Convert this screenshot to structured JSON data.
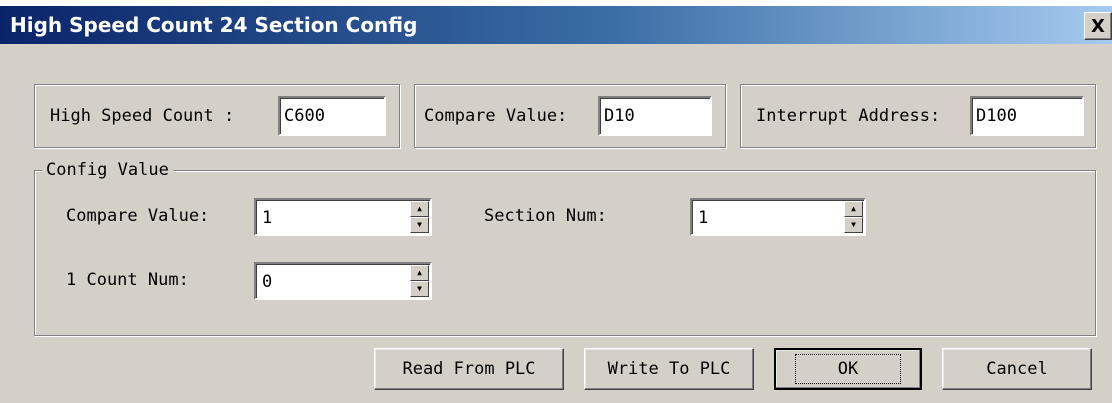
{
  "window": {
    "title": "High Speed Count 24 Section Config",
    "close_label": "X"
  },
  "top": {
    "high_speed_count": {
      "label": "High Speed Count :",
      "value": "C600"
    },
    "compare_value": {
      "label": "Compare Value:",
      "value": "D10"
    },
    "interrupt_address": {
      "label": "Interrupt Address:",
      "value": "D100"
    }
  },
  "config": {
    "legend": "Config Value",
    "compare_value": {
      "label": "Compare Value:",
      "value": "1"
    },
    "section_num": {
      "label": "Section Num:",
      "value": "1"
    },
    "count_num": {
      "label": "1 Count Num:",
      "value": "0"
    }
  },
  "buttons": {
    "read": "Read From PLC",
    "write": "Write To PLC",
    "ok": "OK",
    "cancel": "Cancel"
  },
  "icons": {
    "spin_up": "arrow-up-icon",
    "spin_down": "arrow-down-icon"
  }
}
